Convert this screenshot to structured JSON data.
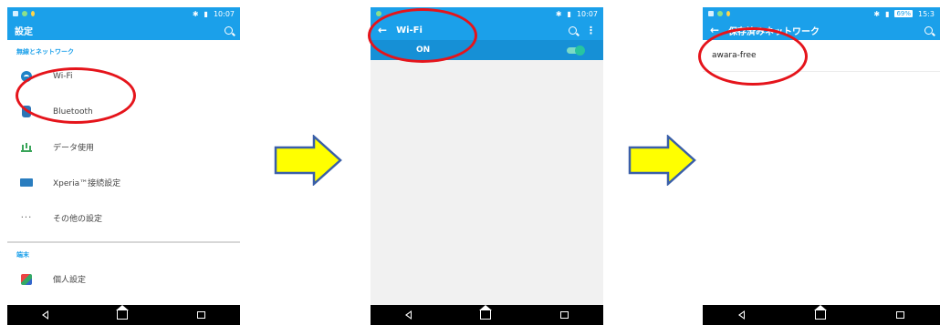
{
  "phone1": {
    "status_time": "10:07",
    "title": "設定",
    "section_wireless": "無線とネットワーク",
    "items": [
      {
        "label": "Wi-Fi",
        "icon": "wifi-icon"
      },
      {
        "label": "Bluetooth",
        "icon": "bluetooth-icon"
      },
      {
        "label": "データ使用",
        "icon": "data-usage-icon"
      },
      {
        "label": "Xperia™接続設定",
        "icon": "xperia-connect-icon"
      },
      {
        "label": "その他の設定",
        "icon": "more-icon"
      }
    ],
    "section_device": "端末",
    "item_personal": "個人設定"
  },
  "phone2": {
    "status_time": "10:07",
    "title": "Wi-Fi",
    "on_label": "ON"
  },
  "phone3": {
    "status_battery": "69%",
    "status_time": "15:3",
    "title": "保存済みネットワーク",
    "networks": [
      "awara-free"
    ]
  },
  "colors": {
    "accent": "#1ba0ea",
    "highlight": "#e5141b",
    "arrow_fill": "#ffff00",
    "arrow_stroke": "#3a5fa8"
  }
}
